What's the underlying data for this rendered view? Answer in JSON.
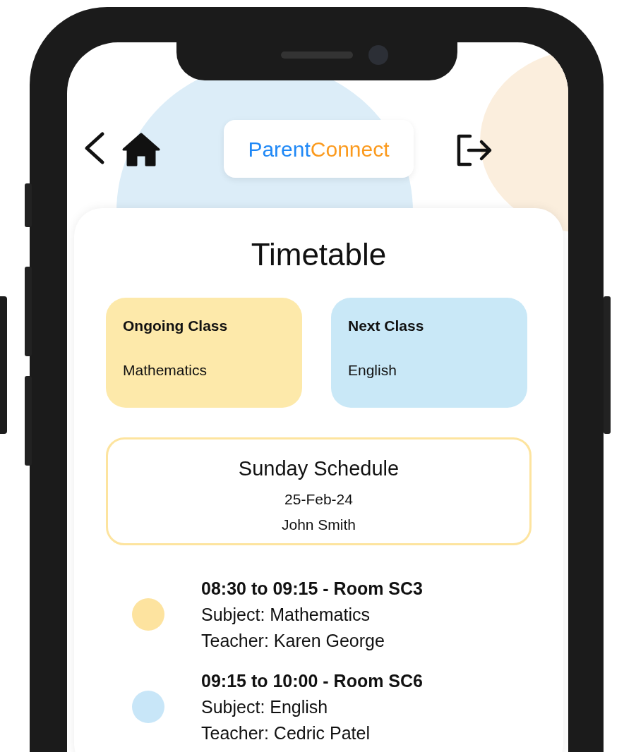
{
  "header": {
    "logo": {
      "first": "Parent",
      "second": "Connect"
    }
  },
  "page": {
    "title": "Timetable"
  },
  "class_cards": [
    {
      "label": "Ongoing Class",
      "subject": "Mathematics",
      "color": "#fde9aa"
    },
    {
      "label": "Next Class",
      "subject": "English",
      "color": "#c9e8f7"
    }
  ],
  "schedule": {
    "title": "Sunday Schedule",
    "date": "25-Feb-24",
    "student": "John Smith"
  },
  "slots": [
    {
      "time": "08:30 to 09:15 - Room SC3",
      "subject": "Subject: Mathematics",
      "teacher": "Teacher: Karen George",
      "color": "#fde39f"
    },
    {
      "time": "09:15 to 10:00 - Room SC6",
      "subject": "Subject: English",
      "teacher": "Teacher: Cedric Patel",
      "color": "#c8e6f8"
    }
  ]
}
